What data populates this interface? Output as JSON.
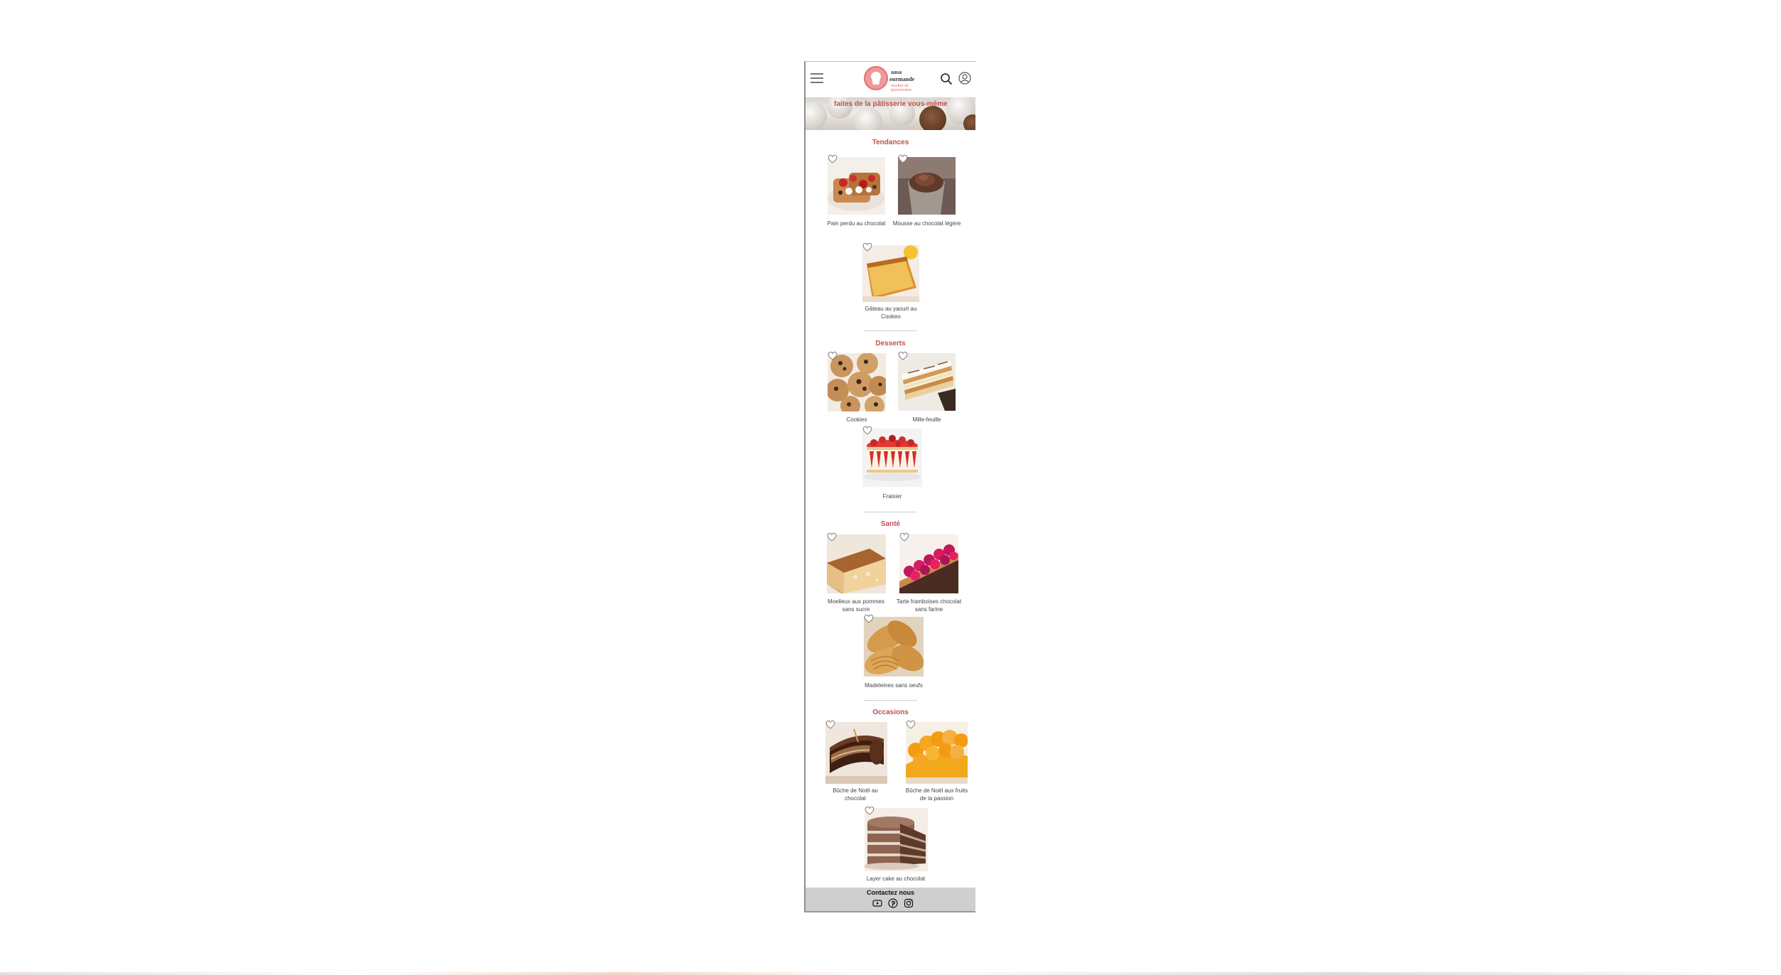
{
  "header": {
    "logo_word1": "aasa",
    "logo_word2": "ourmande",
    "logo_tagline": "recettes de gourmandise"
  },
  "banner": {
    "headline": "faites de la pâtisserie vous-même"
  },
  "sections": [
    {
      "title": "Tendances",
      "items": [
        {
          "name": "Pain perdu au chocolat"
        },
        {
          "name": "Mousse au chocolat légère"
        },
        {
          "name": "Gâteau au yaourt au Cookeo"
        }
      ]
    },
    {
      "title": "Desserts",
      "items": [
        {
          "name": "Cookies"
        },
        {
          "name": "Mille-feuille"
        },
        {
          "name": "Fraisier"
        }
      ]
    },
    {
      "title": "Santé",
      "items": [
        {
          "name": "Moelleux aux pommes sans sucre"
        },
        {
          "name": "Tarte framboises chocolat sans farine"
        },
        {
          "name": "Madeleines sans oeufs"
        }
      ]
    },
    {
      "title": "Occasions",
      "items": [
        {
          "name": "Bûche de Noël au chocolat"
        },
        {
          "name": "Bûche de Noël aux fruits de la passion"
        },
        {
          "name": "Layer cake au chocolat"
        }
      ]
    }
  ],
  "footer": {
    "title": "Contactez nous",
    "social_icons": [
      "youtube-icon",
      "pinterest-icon",
      "instagram-icon"
    ]
  },
  "colors": {
    "accent": "#c0504d",
    "logo_pink": "#ef9a9a",
    "footer_bg": "#cfcfcf"
  }
}
